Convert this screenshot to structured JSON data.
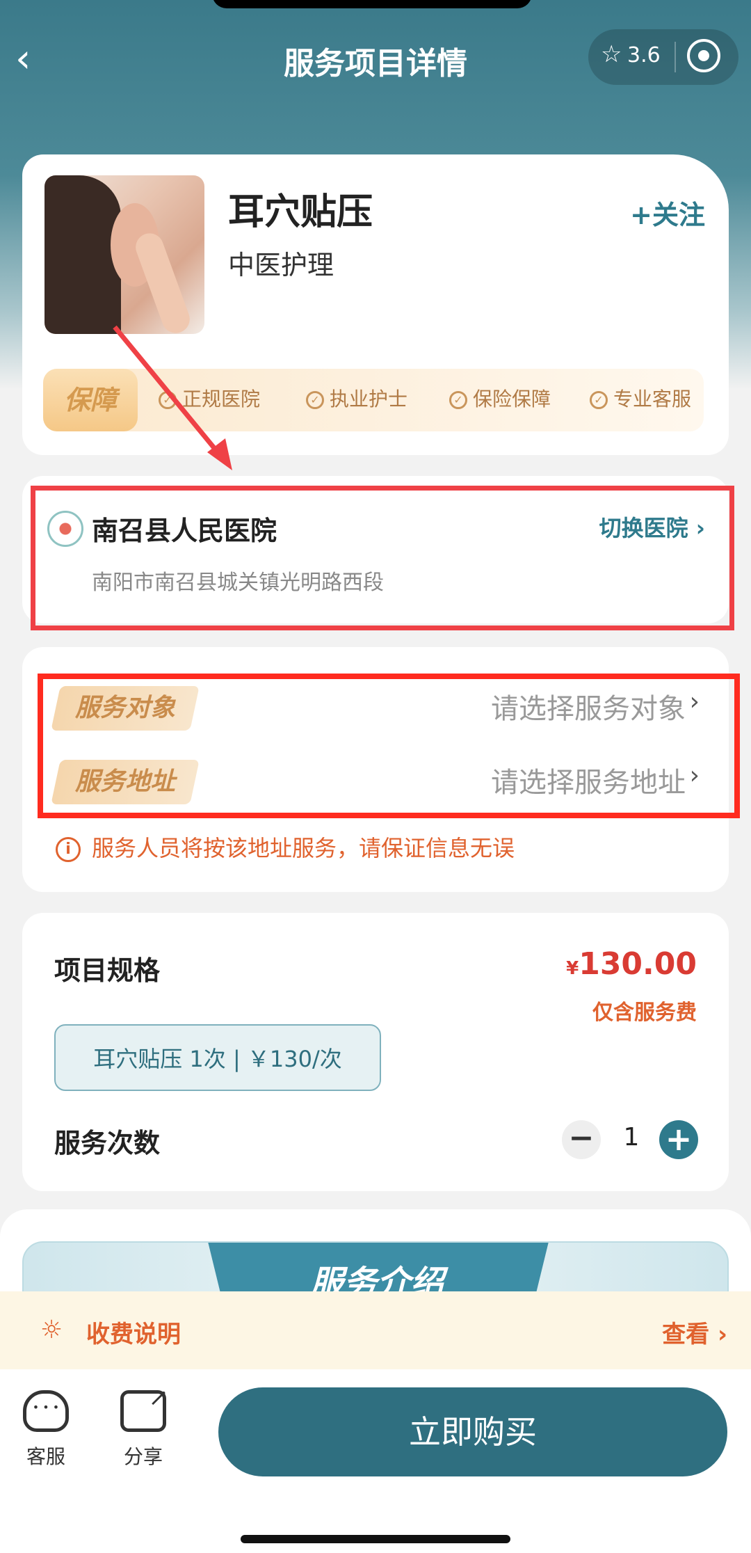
{
  "header": {
    "title": "服务项目详情",
    "back_icon": "‹",
    "rating": "3.6"
  },
  "product": {
    "name": "耳穴贴压",
    "category": "中医护理",
    "follow_label": "+关注"
  },
  "guarantee": {
    "tag": "保障",
    "items": [
      "正规医院",
      "执业护士",
      "保险保障",
      "专业客服"
    ]
  },
  "hospital": {
    "name": "南召县人民医院",
    "switch_label": "切换医院 ›",
    "address": "南阳市南召县城关镇光明路西段"
  },
  "service": {
    "target_label": "服务对象",
    "target_placeholder": "请选择服务对象",
    "address_label": "服务地址",
    "address_placeholder": "请选择服务地址",
    "notice": "服务人员将按该地址服务，请保证信息无误"
  },
  "spec": {
    "title": "项目规格",
    "price_symbol": "¥",
    "price": "130.00",
    "price_note": "仅含服务费",
    "chip": "耳穴贴压   1次  |  ￥130/次",
    "count_title": "服务次数",
    "minus": "−",
    "quantity": "1",
    "plus": "+"
  },
  "intro": {
    "title": "服务介绍"
  },
  "fee": {
    "label": "收费说明",
    "view": "查看 ›"
  },
  "bottom": {
    "service_label": "客服",
    "share_label": "分享",
    "buy_label": "立即购买"
  },
  "colors": {
    "brand": "#2f6f80",
    "accent_orange": "#e0622e",
    "price_red": "#d93b33",
    "highlight_red": "#ef4146"
  }
}
